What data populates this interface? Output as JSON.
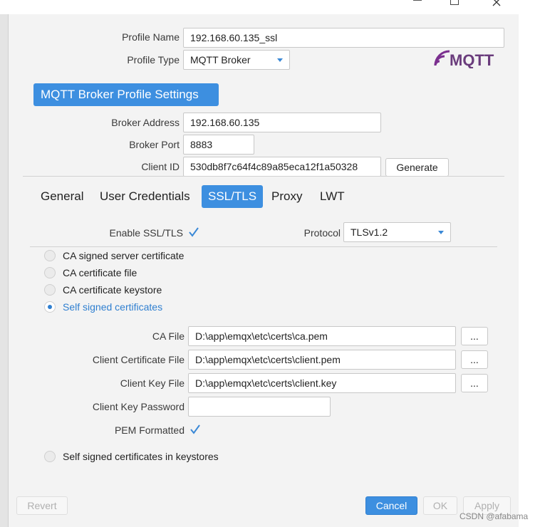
{
  "window": {
    "controls": [
      "minimize",
      "maximize",
      "close"
    ]
  },
  "profile": {
    "name_label": "Profile Name",
    "name_value": "192.168.60.135_ssl",
    "type_label": "Profile Type",
    "type_value": "MQTT Broker",
    "logo_text": "MQTT"
  },
  "broker": {
    "section_title": "MQTT Broker Profile Settings",
    "address_label": "Broker Address",
    "address_value": "192.168.60.135",
    "port_label": "Broker Port",
    "port_value": "8883",
    "client_id_label": "Client ID",
    "client_id_value": "530db8f7c64f4c89a85eca12f1a50328",
    "generate_label": "Generate"
  },
  "tabs": [
    {
      "label": "General",
      "active": false
    },
    {
      "label": "User Credentials",
      "active": false
    },
    {
      "label": "SSL/TLS",
      "active": true
    },
    {
      "label": "Proxy",
      "active": false
    },
    {
      "label": "LWT",
      "active": false
    }
  ],
  "ssl": {
    "enable_label": "Enable SSL/TLS",
    "enable_checked": true,
    "protocol_label": "Protocol",
    "protocol_value": "TLSv1.2",
    "options": [
      {
        "label": "CA signed server certificate",
        "selected": false
      },
      {
        "label": "CA certificate file",
        "selected": false
      },
      {
        "label": "CA certificate keystore",
        "selected": false
      },
      {
        "label": "Self signed certificates",
        "selected": true
      }
    ],
    "ca_file_label": "CA File",
    "ca_file_value": "D:\\app\\emqx\\etc\\certs\\ca.pem",
    "client_cert_label": "Client Certificate File",
    "client_cert_value": "D:\\app\\emqx\\etc\\certs\\client.pem",
    "client_key_label": "Client Key File",
    "client_key_value": "D:\\app\\emqx\\etc\\certs\\client.key",
    "browse_label": "...",
    "key_password_label": "Client Key Password",
    "key_password_value": "",
    "pem_label": "PEM Formatted",
    "pem_checked": true,
    "keystore_option": {
      "label": "Self signed certificates in keystores",
      "selected": false
    }
  },
  "footer": {
    "revert_label": "Revert",
    "cancel_label": "Cancel",
    "ok_label": "OK",
    "apply_label": "Apply"
  },
  "watermark": "CSDN @afabama",
  "colors": {
    "accent": "#3d8fe0",
    "selected_text": "#2f7fd0"
  }
}
